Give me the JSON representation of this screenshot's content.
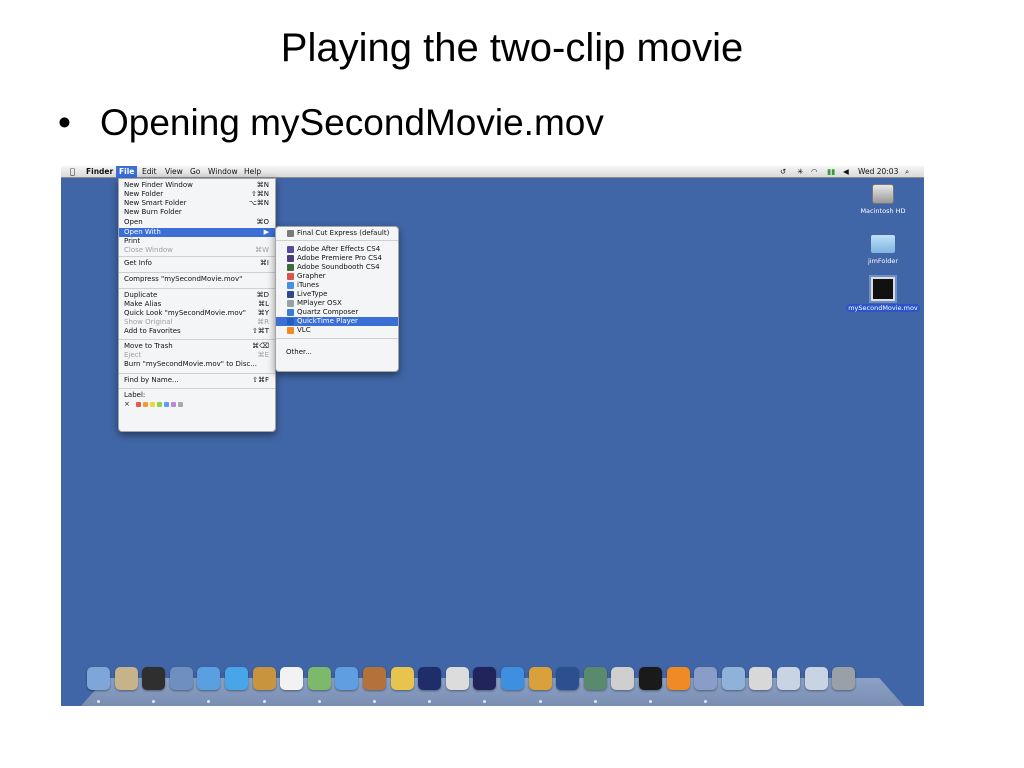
{
  "slide": {
    "title": "Playing the two-clip movie",
    "bullet": "Opening mySecondMovie.mov",
    "bullet_marker": "•"
  },
  "menubar": {
    "apple": "",
    "items": [
      "Finder",
      "File",
      "Edit",
      "View",
      "Go",
      "Window",
      "Help"
    ],
    "clock": "Wed 20:03",
    "status_icons": [
      "time-machine-icon",
      "bluetooth-icon",
      "wifi-icon",
      "battery-icon",
      "volume-icon",
      "spotlight-icon"
    ]
  },
  "file_menu": {
    "items": [
      {
        "label": "New Finder Window",
        "shortcut": "⌘N"
      },
      {
        "label": "New Folder",
        "shortcut": "⇧⌘N"
      },
      {
        "label": "New Smart Folder",
        "shortcut": "⌥⌘N"
      },
      {
        "label": "New Burn Folder",
        "shortcut": ""
      },
      {
        "label": "Open",
        "shortcut": "⌘O"
      },
      {
        "label": "Open With",
        "shortcut": "▶"
      },
      {
        "label": "Print",
        "shortcut": ""
      },
      {
        "label": "Close Window",
        "shortcut": "⌘W"
      },
      {
        "label": "Get Info",
        "shortcut": "⌘I"
      },
      {
        "label": "Compress \"mySecondMovie.mov\"",
        "shortcut": ""
      },
      {
        "label": "Duplicate",
        "shortcut": "⌘D"
      },
      {
        "label": "Make Alias",
        "shortcut": "⌘L"
      },
      {
        "label": "Quick Look \"mySecondMovie.mov\"",
        "shortcut": "⌘Y"
      },
      {
        "label": "Show Original",
        "shortcut": "⌘R"
      },
      {
        "label": "Add to Favorites",
        "shortcut": "⇧⌘T"
      },
      {
        "label": "Move to Trash",
        "shortcut": "⌘⌫"
      },
      {
        "label": "Eject",
        "shortcut": "⌘E"
      },
      {
        "label": "Burn \"mySecondMovie.mov\" to Disc...",
        "shortcut": ""
      },
      {
        "label": "Find by Name...",
        "shortcut": "⇧⌘F"
      },
      {
        "label": "Label:",
        "shortcut": ""
      },
      {
        "label": "×",
        "shortcut": ""
      }
    ],
    "label_colors": [
      "#e8574a",
      "#f29a38",
      "#f2d43e",
      "#8fd14f",
      "#5b9cf0",
      "#b58ad8",
      "#a8a8a8"
    ]
  },
  "open_with_menu": {
    "items": [
      {
        "label": "Final Cut Express (default)",
        "icon_color": "#7a7a7a"
      },
      {
        "label": "Adobe After Effects CS4",
        "icon_color": "#5a4a9c"
      },
      {
        "label": "Adobe Premiere Pro CS4",
        "icon_color": "#4b3d80"
      },
      {
        "label": "Adobe Soundbooth CS4",
        "icon_color": "#3d6b3a"
      },
      {
        "label": "Grapher",
        "icon_color": "#d9534f"
      },
      {
        "label": "iTunes",
        "icon_color": "#4a90e2"
      },
      {
        "label": "LiveType",
        "icon_color": "#2f4a8a"
      },
      {
        "label": "MPlayer OSX",
        "icon_color": "#9aa0a8"
      },
      {
        "label": "Quartz Composer",
        "icon_color": "#3a7bd5"
      },
      {
        "label": "QuickTime Player",
        "icon_color": "#1f5fc4"
      },
      {
        "label": "VLC",
        "icon_color": "#f08a24"
      },
      {
        "label": "Other...",
        "icon_color": ""
      }
    ]
  },
  "desktop": {
    "items": [
      {
        "label": "Macintosh HD",
        "icon": "hard-drive-icon"
      },
      {
        "label": "jimFolder",
        "icon": "folder-icon"
      },
      {
        "label": "mySecondMovie.mov",
        "icon": "movie-file-icon"
      }
    ]
  },
  "dock": {
    "colors": [
      "#7fa6d8",
      "#c7b38a",
      "#2f2f2f",
      "#6f8fc0",
      "#5aa0e0",
      "#48a6e8",
      "#c9943e",
      "#f2f2f2",
      "#7cb96b",
      "#5f9ee0",
      "#b5713a",
      "#e6c44d",
      "#1f2d6b",
      "#dcdcdc",
      "#20245a",
      "#3f8fe0",
      "#d9a03c",
      "#2b4f8f",
      "#5a8a6e",
      "#cfcfcf",
      "#1a1a1a",
      "#f08a24",
      "#8a9cc8",
      "#8fb2d8",
      "#d8d8d8",
      "#c8d4e4",
      "#c8d4e4",
      "#9aa0a8"
    ]
  }
}
